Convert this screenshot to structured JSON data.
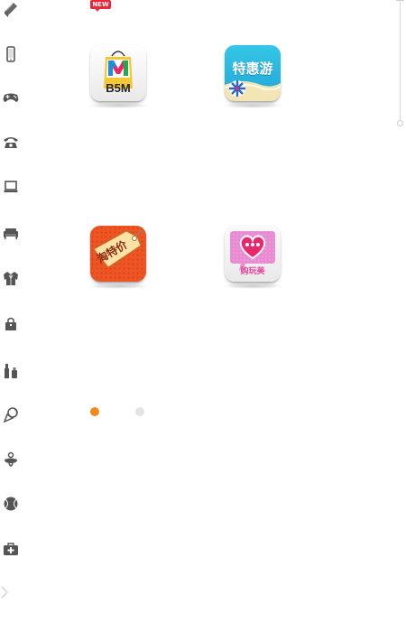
{
  "sidebar": {
    "items": [
      {
        "icon": "book-icon"
      },
      {
        "icon": "phone-icon"
      },
      {
        "icon": "gamepad-icon"
      },
      {
        "icon": "telephone-icon"
      },
      {
        "icon": "laptop-icon"
      },
      {
        "icon": "sofa-icon"
      },
      {
        "icon": "jacket-icon"
      },
      {
        "icon": "handbag-icon"
      },
      {
        "icon": "cosmetics-icon"
      },
      {
        "icon": "ice-cream-icon"
      },
      {
        "icon": "pacifier-icon"
      },
      {
        "icon": "ball-icon"
      },
      {
        "icon": "medical-kit-icon"
      }
    ],
    "more_icon": "chevron-right-icon"
  },
  "badge": {
    "text": "NEW",
    "color": "#e8283b"
  },
  "apps": [
    {
      "id": "b5m",
      "label": "B5M"
    },
    {
      "id": "tehui",
      "label": "特惠游"
    },
    {
      "id": "tao",
      "label": "淘特价"
    },
    {
      "id": "gou",
      "label": "购玩美"
    }
  ],
  "pager": {
    "total": 2,
    "current": 1,
    "active_color": "#f08a1f",
    "inactive_color": "#e3e3e3"
  }
}
